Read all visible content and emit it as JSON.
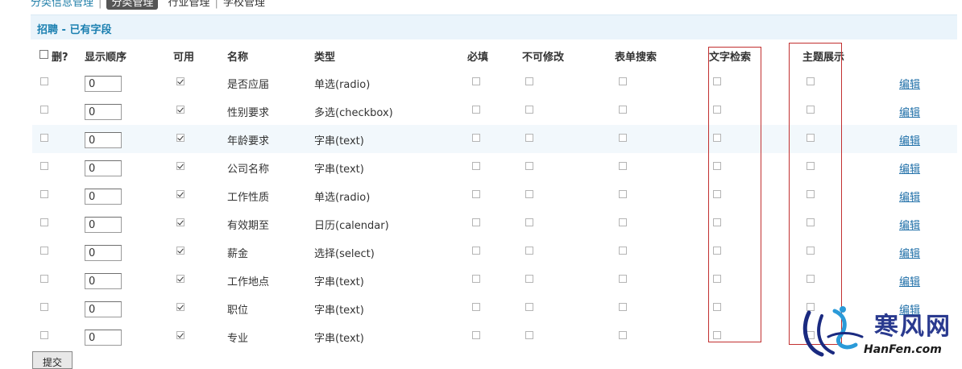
{
  "breadcrumb": {
    "item1": "分类信息管理",
    "item2": "分类管理",
    "item3": "行业管理",
    "item4": "学校管理"
  },
  "section": {
    "title": "招聘 - 已有字段"
  },
  "columns": {
    "delete": "删?",
    "order": "显示顺序",
    "enabled": "可用",
    "name": "名称",
    "type": "类型",
    "required": "必填",
    "readonly": "不可修改",
    "form_search": "表单搜索",
    "text_search": "文字检索",
    "topic_display": "主题展示"
  },
  "rows": [
    {
      "order": "0",
      "name": "是否应届",
      "type": "单选(radio)",
      "edit": "编辑"
    },
    {
      "order": "0",
      "name": "性别要求",
      "type": "多选(checkbox)",
      "edit": "编辑"
    },
    {
      "order": "0",
      "name": "年龄要求",
      "type": "字串(text)",
      "edit": "编辑"
    },
    {
      "order": "0",
      "name": "公司名称",
      "type": "字串(text)",
      "edit": "编辑"
    },
    {
      "order": "0",
      "name": "工作性质",
      "type": "单选(radio)",
      "edit": "编辑"
    },
    {
      "order": "0",
      "name": "有效期至",
      "type": "日历(calendar)",
      "edit": "编辑"
    },
    {
      "order": "0",
      "name": "薪金",
      "type": "选择(select)",
      "edit": "编辑"
    },
    {
      "order": "0",
      "name": "工作地点",
      "type": "字串(text)",
      "edit": "编辑"
    },
    {
      "order": "0",
      "name": "职位",
      "type": "字串(text)",
      "edit": "编辑"
    },
    {
      "order": "0",
      "name": "专业",
      "type": "字串(text)"
    }
  ],
  "submit_label": "提交",
  "watermark": {
    "cn": "寒风网",
    "en": "HanFen.com"
  },
  "colors": {
    "accent": "#1a7fb0",
    "highlight": "#c23030",
    "header_bg": "#eaf4fb"
  }
}
